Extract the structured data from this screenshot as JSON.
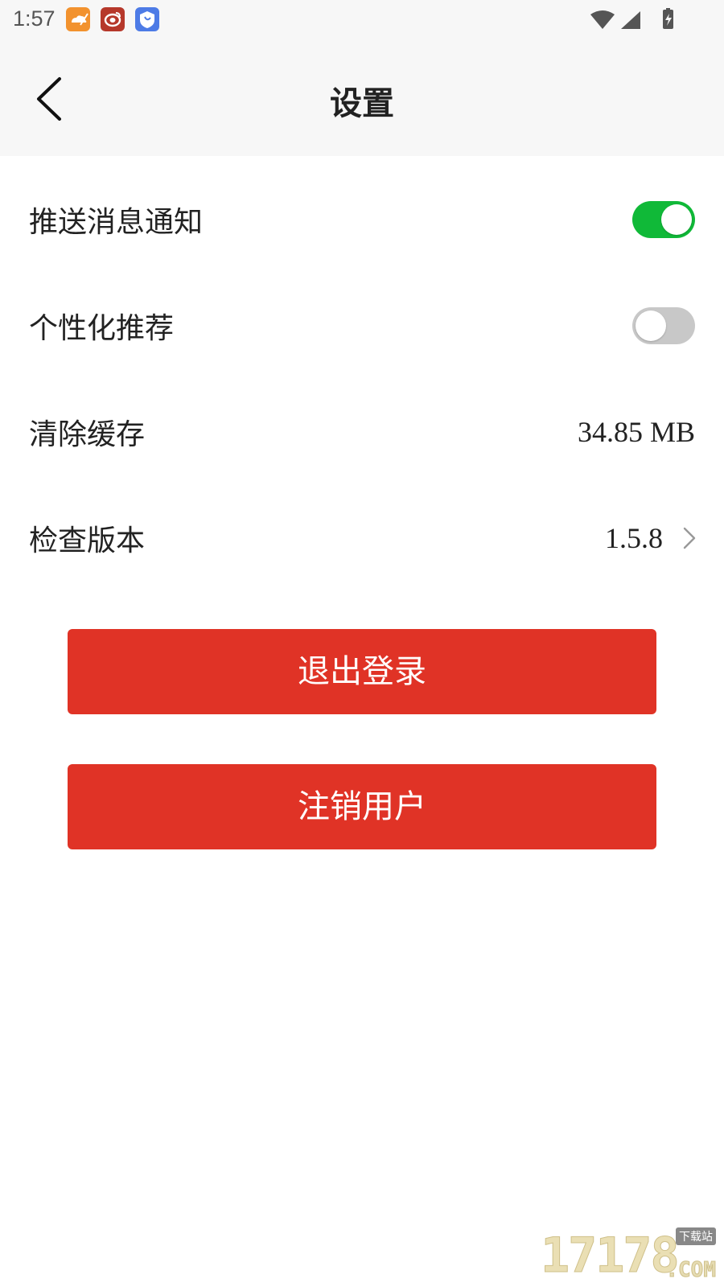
{
  "status_bar": {
    "time": "1:57",
    "left_icons": [
      "weather-app-icon",
      "weibo-app-icon",
      "shield-app-icon"
    ],
    "right_icons": [
      "wifi-icon",
      "cell-signal-icon",
      "battery-charging-icon"
    ]
  },
  "header": {
    "title": "设置",
    "back_icon": "chevron-left-icon"
  },
  "settings": {
    "push_notifications": {
      "label": "推送消息通知",
      "enabled": true
    },
    "personalized_recommendations": {
      "label": "个性化推荐",
      "enabled": false
    },
    "clear_cache": {
      "label": "清除缓存",
      "value": "34.85 MB"
    },
    "check_version": {
      "label": "检查版本",
      "value": "1.5.8"
    }
  },
  "actions": {
    "logout_label": "退出登录",
    "deregister_label": "注销用户"
  },
  "watermark": {
    "digits": "17178",
    "tag": "下载站",
    "suffix": ".COM"
  },
  "colors": {
    "accent_red": "#e03326",
    "toggle_on": "#10b938",
    "toggle_off": "#c8c8c8",
    "header_bg": "#f7f7f7"
  }
}
